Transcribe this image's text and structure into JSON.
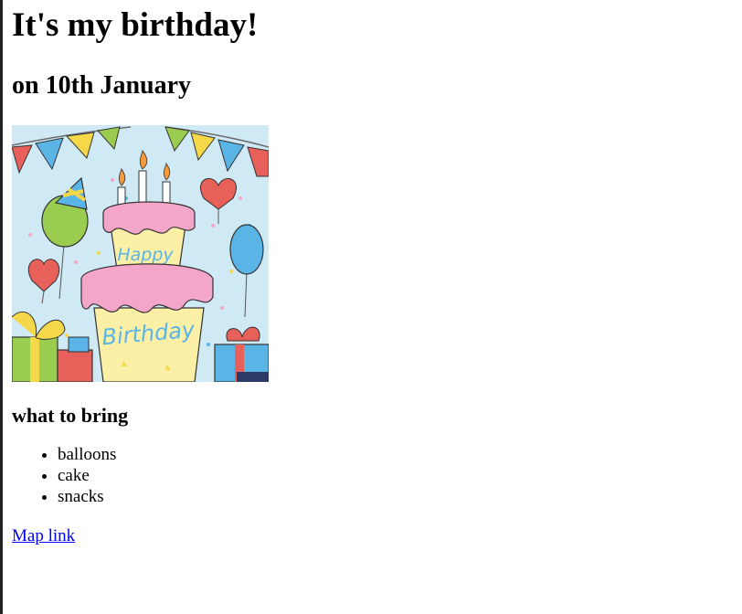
{
  "title": "It's my birthday!",
  "subtitle": "on 10th January",
  "image": {
    "description": "birthday cake illustration",
    "cake_top_text": "Happy",
    "cake_bottom_text": "Birthday",
    "colors": {
      "background": "#cfe9f5",
      "frosting": "#f3a6c8",
      "cake": "#fbf0a6",
      "text": "#5ab4e6"
    }
  },
  "section_heading": "what to bring",
  "items": [
    "balloons",
    "cake",
    "snacks"
  ],
  "link": {
    "label": "Map link",
    "color": "#0000ee"
  }
}
